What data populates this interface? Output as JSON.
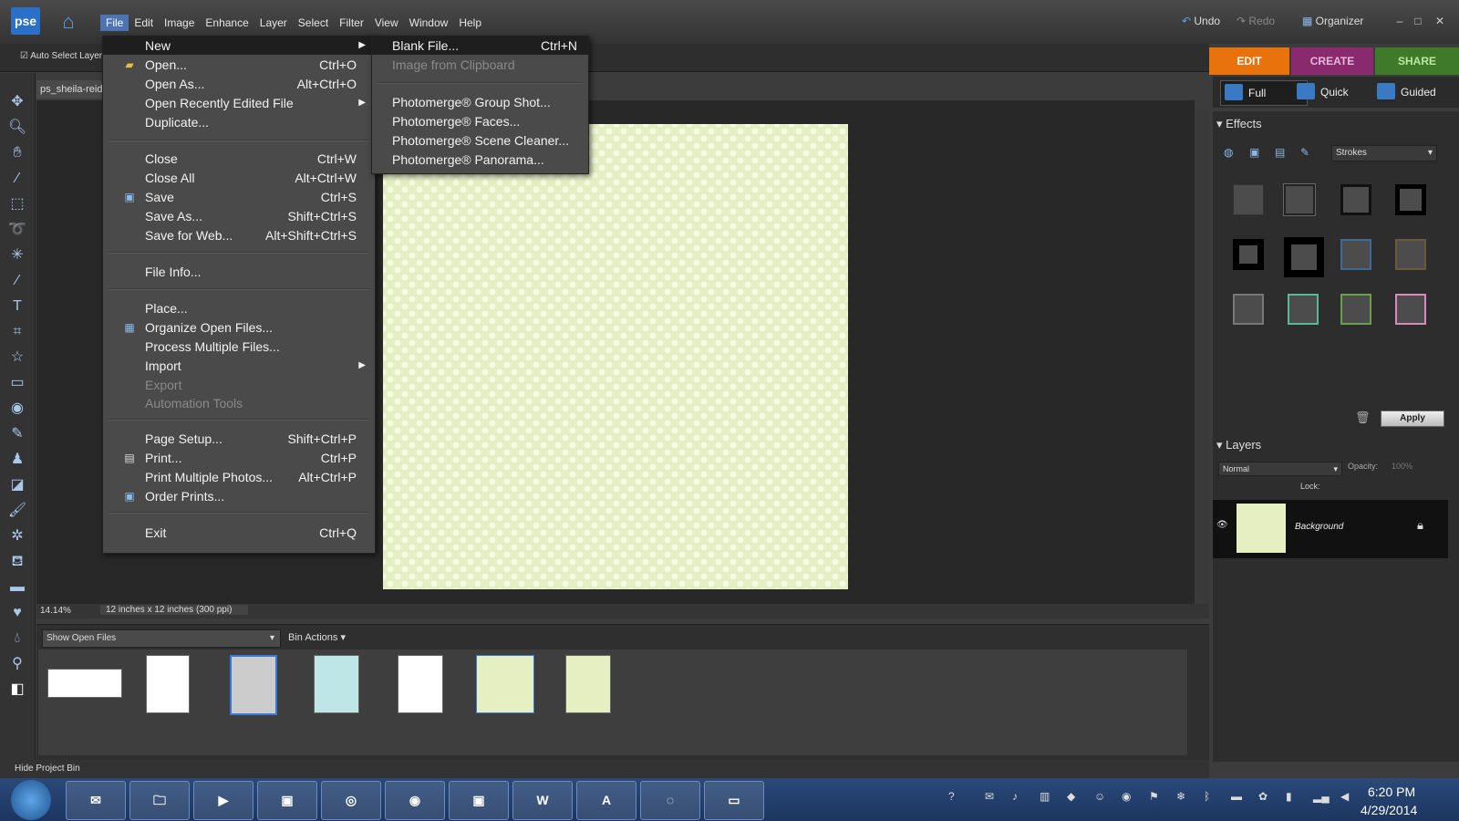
{
  "app": {
    "logo": "pse"
  },
  "menubar": [
    "File",
    "Edit",
    "Image",
    "Enhance",
    "Layer",
    "Select",
    "Filter",
    "View",
    "Window",
    "Help"
  ],
  "header": {
    "undo": "Undo",
    "redo": "Redo",
    "organizer": "Organizer"
  },
  "options": {
    "auto_select": "Auto Select Layer"
  },
  "modes": {
    "edit": "EDIT",
    "create": "CREATE",
    "share": "SHARE"
  },
  "submodes": {
    "full": "Full",
    "quick": "Quick",
    "guided": "Guided"
  },
  "document": {
    "tab": "ps_sheila-reid",
    "zoom": "14.14%",
    "size": "12 inches x 12 inches (300 ppi)"
  },
  "file_menu": {
    "new": "New",
    "items": [
      {
        "label": "Open...",
        "shortcut": "Ctrl+O"
      },
      {
        "label": "Open As...",
        "shortcut": "Alt+Ctrl+O"
      },
      {
        "label": "Open Recently Edited File",
        "shortcut": ""
      },
      {
        "label": "Duplicate...",
        "shortcut": ""
      },
      {
        "label": "Close",
        "shortcut": "Ctrl+W"
      },
      {
        "label": "Close All",
        "shortcut": "Alt+Ctrl+W"
      },
      {
        "label": "Save",
        "shortcut": "Ctrl+S"
      },
      {
        "label": "Save As...",
        "shortcut": "Shift+Ctrl+S"
      },
      {
        "label": "Save for Web...",
        "shortcut": "Alt+Shift+Ctrl+S"
      },
      {
        "label": "File Info...",
        "shortcut": ""
      },
      {
        "label": "Place...",
        "shortcut": ""
      },
      {
        "label": "Organize Open Files...",
        "shortcut": ""
      },
      {
        "label": "Process Multiple Files...",
        "shortcut": ""
      },
      {
        "label": "Import",
        "shortcut": ""
      },
      {
        "label": "Export",
        "shortcut": ""
      },
      {
        "label": "Automation Tools",
        "shortcut": ""
      },
      {
        "label": "Page Setup...",
        "shortcut": "Shift+Ctrl+P"
      },
      {
        "label": "Print...",
        "shortcut": "Ctrl+P"
      },
      {
        "label": "Print Multiple Photos...",
        "shortcut": "Alt+Ctrl+P"
      },
      {
        "label": "Order Prints...",
        "shortcut": ""
      },
      {
        "label": "Exit",
        "shortcut": "Ctrl+Q"
      }
    ]
  },
  "new_submenu": [
    {
      "label": "Blank File...",
      "shortcut": "Ctrl+N"
    },
    {
      "label": "Image from Clipboard",
      "shortcut": ""
    },
    {
      "label": "Photomerge® Group Shot...",
      "shortcut": ""
    },
    {
      "label": "Photomerge® Faces...",
      "shortcut": ""
    },
    {
      "label": "Photomerge® Scene Cleaner...",
      "shortcut": ""
    },
    {
      "label": "Photomerge® Panorama...",
      "shortcut": ""
    }
  ],
  "bin": {
    "show": "Show Open Files",
    "actions": "Bin Actions",
    "hide": "Hide Project Bin"
  },
  "effects": {
    "title": "Effects",
    "category": "Strokes",
    "apply": "Apply"
  },
  "layers": {
    "title": "Layers",
    "blend": "Normal",
    "opacity_label": "Opacity:",
    "opacity": "100%",
    "lock_label": "Lock:",
    "layer_name": "Background"
  },
  "taskbar": {
    "time": "6:20 PM",
    "date": "4/29/2014"
  },
  "colors": {
    "edit_tab": "#e8720c",
    "create_tab": "#8a2a6e",
    "share_tab": "#3f7a2a",
    "canvas": "#e6efc2"
  }
}
